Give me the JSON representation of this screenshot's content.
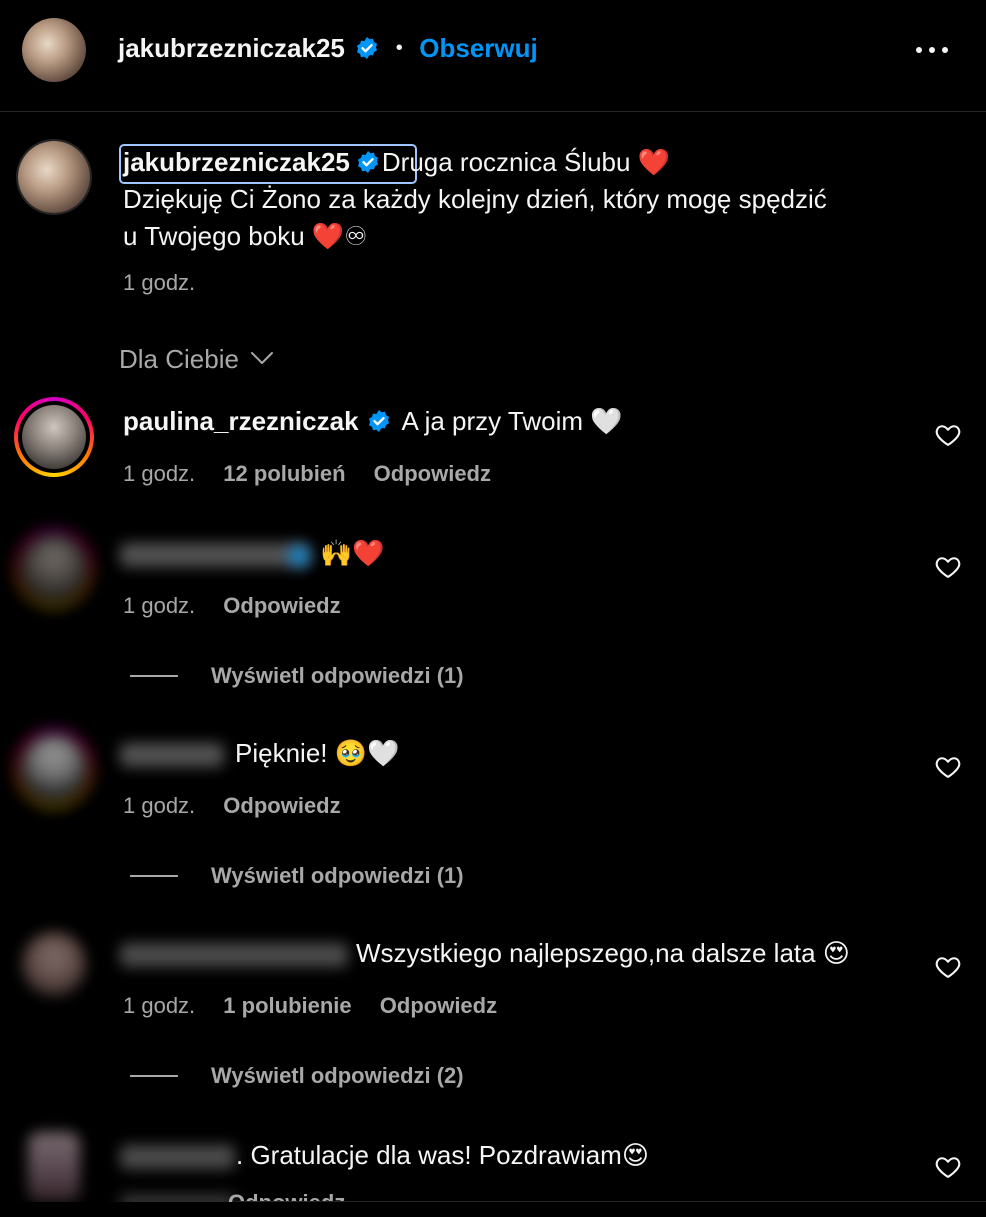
{
  "header": {
    "username": "jakubrzezniczak25",
    "separator": "•",
    "follow_label": "Obserwuj",
    "more_icon": "more-horizontal-icon"
  },
  "post": {
    "username": "jakubrzezniczak25",
    "caption_line1": "Druga rocznica Ślubu ❤️",
    "caption_line2": "Dziękuję Ci Żono za każdy kolejny dzień, który mogę spędzić",
    "caption_line3": "u Twojego boku ❤️♾",
    "time": "1 godz."
  },
  "sort": {
    "label": "Dla Ciebie",
    "icon": "chevron-down-icon"
  },
  "comments": [
    {
      "username": "paulina_rzezniczak",
      "verified": true,
      "text": "A ja przy Twoim 🤍",
      "time": "1 godz.",
      "likes": "12 polubień",
      "reply": "Odpowiedz"
    },
    {
      "username": "",
      "text": "🙌❤️",
      "time": "1 godz.",
      "likes": "",
      "reply": "Odpowiedz",
      "view_replies": "Wyświetl odpowiedzi (1)"
    },
    {
      "username": "",
      "text": "Pięknie! 🥹🤍",
      "time": "1 godz.",
      "likes": "",
      "reply": "Odpowiedz",
      "view_replies": "Wyświetl odpowiedzi (1)"
    },
    {
      "username": "",
      "text": "Wszystkiego najlepszego,na dalsze lata 😍",
      "time": "1 godz.",
      "likes": "1 polubienie",
      "reply": "Odpowiedz",
      "view_replies": "Wyświetl odpowiedzi (2)"
    },
    {
      "username": "",
      "text": ". Gratulacje dla was! Pozdrawiam😍",
      "time": "",
      "likes": "",
      "reply": "Odpowiedz"
    }
  ],
  "colors": {
    "background": "#000000",
    "link_blue": "#0095f6",
    "muted_text": "#a8a8a8",
    "text": "#f5f5f5"
  }
}
